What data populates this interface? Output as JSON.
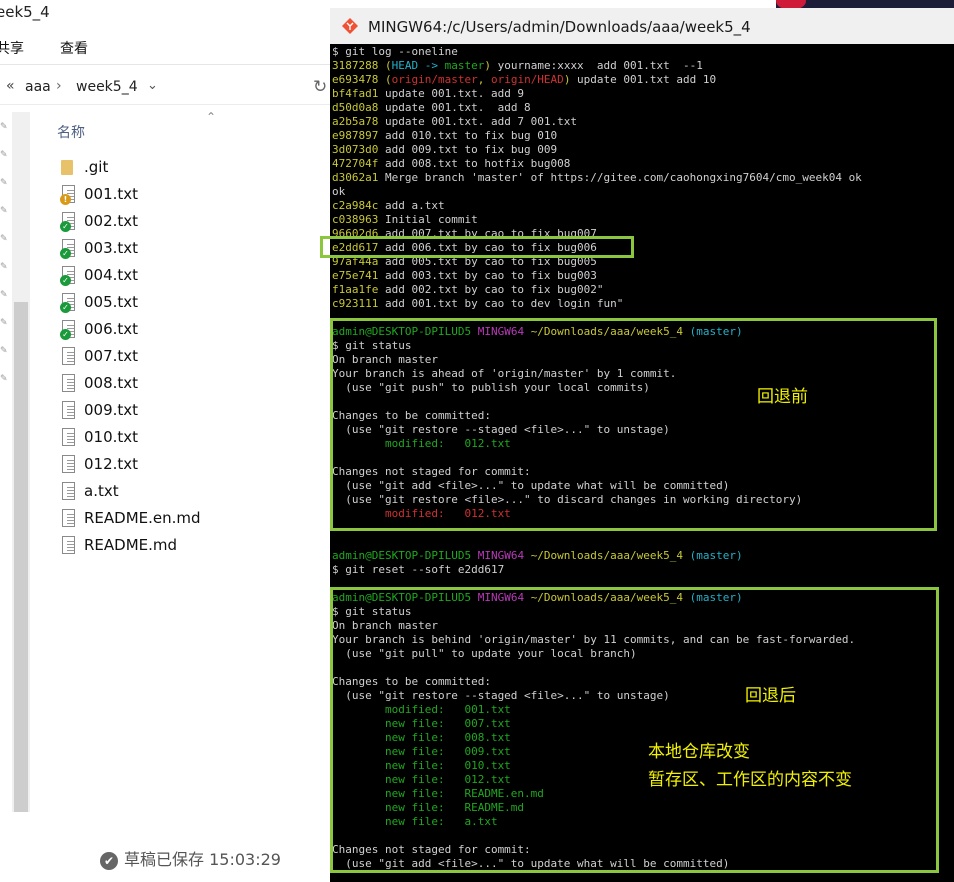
{
  "explorer": {
    "title_fragment": "eek5_4",
    "menu": {
      "share": "共享",
      "view": "查看"
    },
    "address": {
      "prefix": "«",
      "segments": [
        "aaa",
        "week5_4"
      ],
      "separator": "›"
    },
    "column_name": "名称",
    "files": [
      {
        "name": ".git",
        "type": "folder",
        "badge": ""
      },
      {
        "name": "001.txt",
        "type": "doc",
        "badge": "warn"
      },
      {
        "name": "002.txt",
        "type": "doc",
        "badge": "ok"
      },
      {
        "name": "003.txt",
        "type": "doc",
        "badge": "ok"
      },
      {
        "name": "004.txt",
        "type": "doc",
        "badge": "ok"
      },
      {
        "name": "005.txt",
        "type": "doc",
        "badge": "ok"
      },
      {
        "name": "006.txt",
        "type": "doc",
        "badge": "ok"
      },
      {
        "name": "007.txt",
        "type": "doc",
        "badge": ""
      },
      {
        "name": "008.txt",
        "type": "doc",
        "badge": ""
      },
      {
        "name": "009.txt",
        "type": "doc",
        "badge": ""
      },
      {
        "name": "010.txt",
        "type": "doc",
        "badge": ""
      },
      {
        "name": "012.txt",
        "type": "doc",
        "badge": ""
      },
      {
        "name": "a.txt",
        "type": "doc",
        "badge": ""
      },
      {
        "name": "README.en.md",
        "type": "doc",
        "badge": ""
      },
      {
        "name": "README.md",
        "type": "doc",
        "badge": ""
      }
    ],
    "status": "草稿已保存 15:03:29"
  },
  "terminal": {
    "title": "MINGW64:/c/Users/admin/Downloads/aaa/week5_4",
    "lines": [
      [
        [
          "$ git log --oneline",
          "white"
        ]
      ],
      [
        [
          "3187288 ",
          "yellow"
        ],
        [
          "(",
          "yellow"
        ],
        [
          "HEAD -> ",
          "cyan"
        ],
        [
          "master",
          "green"
        ],
        [
          ")",
          "yellow"
        ],
        [
          " yourname:xxxx  add 001.txt  --1",
          "white"
        ]
      ],
      [
        [
          "e693478 ",
          "yellow"
        ],
        [
          "(",
          "yellow"
        ],
        [
          "origin/master",
          "red"
        ],
        [
          ", ",
          "yellow"
        ],
        [
          "origin/HEAD",
          "red"
        ],
        [
          ")",
          "yellow"
        ],
        [
          " update 001.txt add 10",
          "white"
        ]
      ],
      [
        [
          "bf4fad1 ",
          "yellow"
        ],
        [
          "update 001.txt. add 9",
          "white"
        ]
      ],
      [
        [
          "d50d0a8 ",
          "yellow"
        ],
        [
          "update 001.txt.  add 8",
          "white"
        ]
      ],
      [
        [
          "a2b5a78 ",
          "yellow"
        ],
        [
          "update 001.txt. add 7 001.txt",
          "white"
        ]
      ],
      [
        [
          "e987897 ",
          "yellow"
        ],
        [
          "add 010.txt to fix bug 010",
          "white"
        ]
      ],
      [
        [
          "3d073d0 ",
          "yellow"
        ],
        [
          "add 009.txt to fix bug 009",
          "white"
        ]
      ],
      [
        [
          "472704f ",
          "yellow"
        ],
        [
          "add 008.txt to hotfix bug008",
          "white"
        ]
      ],
      [
        [
          "d3062a1 ",
          "yellow"
        ],
        [
          "Merge branch 'master' of https://gitee.com/caohongxing7604/cmo_week04 ok",
          "white"
        ]
      ],
      [
        [
          "ok",
          "white"
        ]
      ],
      [
        [
          "c2a984c ",
          "yellow"
        ],
        [
          "add a.txt",
          "white"
        ]
      ],
      [
        [
          "c038963 ",
          "yellow"
        ],
        [
          "Initial commit",
          "white"
        ]
      ],
      [
        [
          "96602d6 ",
          "yellow"
        ],
        [
          "add 007.txt by cao to fix bug007",
          "white"
        ]
      ],
      [
        [
          "e2dd617 ",
          "yellow"
        ],
        [
          "add 006.txt by cao to fix bug006",
          "white"
        ]
      ],
      [
        [
          "97af44a ",
          "yellow"
        ],
        [
          "add 005.txt by cao to fix bug005",
          "white"
        ]
      ],
      [
        [
          "e75e741 ",
          "yellow"
        ],
        [
          "add 003.txt by cao to fix bug003",
          "white"
        ]
      ],
      [
        [
          "f1aa1fe ",
          "yellow"
        ],
        [
          "add 002.txt by cao to fix bug002\"",
          "white"
        ]
      ],
      [
        [
          "c923111 ",
          "yellow"
        ],
        [
          "add 001.txt by cao to dev login fun\"",
          "white"
        ]
      ],
      [],
      [
        [
          "admin@DESKTOP-DPILUD5 ",
          "green"
        ],
        [
          "MINGW64 ",
          "magenta"
        ],
        [
          "~/Downloads/aaa/week5_4 ",
          "yellow"
        ],
        [
          "(master)",
          "cyan"
        ]
      ],
      [
        [
          "$ git status",
          "white"
        ]
      ],
      [
        [
          "On branch master",
          "white"
        ]
      ],
      [
        [
          "Your branch is ahead of 'origin/master' by 1 commit.",
          "white"
        ]
      ],
      [
        [
          "  (use \"git push\" to publish your local commits)",
          "white"
        ]
      ],
      [],
      [
        [
          "Changes to be committed:",
          "white"
        ]
      ],
      [
        [
          "  (use \"git restore --staged <file>...\" to unstage)",
          "white"
        ]
      ],
      [
        [
          "        modified:   012.txt",
          "green"
        ]
      ],
      [],
      [
        [
          "Changes not staged for commit:",
          "white"
        ]
      ],
      [
        [
          "  (use \"git add <file>...\" to update what will be committed)",
          "white"
        ]
      ],
      [
        [
          "  (use \"git restore <file>...\" to discard changes in working directory)",
          "white"
        ]
      ],
      [
        [
          "        modified:   012.txt",
          "red"
        ]
      ],
      [],
      [],
      [
        [
          "admin@DESKTOP-DPILUD5 ",
          "green"
        ],
        [
          "MINGW64 ",
          "magenta"
        ],
        [
          "~/Downloads/aaa/week5_4 ",
          "yellow"
        ],
        [
          "(master)",
          "cyan"
        ]
      ],
      [
        [
          "$ git reset --soft e2dd617",
          "white"
        ]
      ],
      [],
      [
        [
          "admin@DESKTOP-DPILUD5 ",
          "green"
        ],
        [
          "MINGW64 ",
          "magenta"
        ],
        [
          "~/Downloads/aaa/week5_4 ",
          "yellow"
        ],
        [
          "(master)",
          "cyan"
        ]
      ],
      [
        [
          "$ git status",
          "white"
        ]
      ],
      [
        [
          "On branch master",
          "white"
        ]
      ],
      [
        [
          "Your branch is behind 'origin/master' by 11 commits, and can be fast-forwarded.",
          "white"
        ]
      ],
      [
        [
          "  (use \"git pull\" to update your local branch)",
          "white"
        ]
      ],
      [],
      [
        [
          "Changes to be committed:",
          "white"
        ]
      ],
      [
        [
          "  (use \"git restore --staged <file>...\" to unstage)",
          "white"
        ]
      ],
      [
        [
          "        modified:   001.txt",
          "green"
        ]
      ],
      [
        [
          "        new file:   007.txt",
          "green"
        ]
      ],
      [
        [
          "        new file:   008.txt",
          "green"
        ]
      ],
      [
        [
          "        new file:   009.txt",
          "green"
        ]
      ],
      [
        [
          "        new file:   010.txt",
          "green"
        ]
      ],
      [
        [
          "        new file:   012.txt",
          "green"
        ]
      ],
      [
        [
          "        new file:   README.en.md",
          "green"
        ]
      ],
      [
        [
          "        new file:   README.md",
          "green"
        ]
      ],
      [
        [
          "        new file:   a.txt",
          "green"
        ]
      ],
      [],
      [
        [
          "Changes not staged for commit:",
          "white"
        ]
      ],
      [
        [
          "  (use \"git add <file>...\" to update what will be committed)",
          "white"
        ]
      ]
    ]
  },
  "annotations": {
    "before": "回退前",
    "after": "回退后",
    "note1": "本地仓库改变",
    "note2": "暂存区、工作区的内容不变"
  },
  "colors": {
    "yellow": "#c8c836",
    "cyan": "#24b0c8",
    "red": "#d03030",
    "green": "#1fa81f",
    "magenta": "#b83ab8",
    "white": "#d0d0d0",
    "highlight_box": "#8cc63f",
    "annotation": "#f0f000"
  }
}
